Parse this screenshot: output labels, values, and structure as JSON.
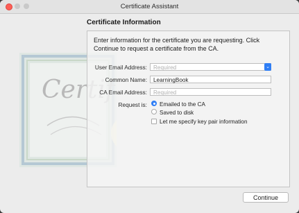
{
  "window": {
    "title": "Certificate Assistant"
  },
  "section": {
    "title": "Certificate Information"
  },
  "intro": "Enter information for the certificate you are requesting. Click Continue to request a certificate from the CA.",
  "artwork": {
    "script_text": "Certif"
  },
  "form": {
    "user_email": {
      "label": "User Email Address:",
      "placeholder": "Required",
      "value": ""
    },
    "common_name": {
      "label": "Common Name:",
      "value": "LearningBook"
    },
    "ca_email": {
      "label": "CA Email Address:",
      "placeholder": "Required",
      "value": ""
    },
    "request": {
      "label": "Request is:",
      "options": [
        "Emailed to the CA",
        "Saved to disk"
      ],
      "selected": "Emailed to the CA"
    },
    "keypair_checkbox": {
      "label": "Let me specify key pair information",
      "checked": false
    }
  },
  "buttons": {
    "continue": "Continue"
  },
  "colors": {
    "accent": "#2f7ef5",
    "close": "#fd5f57"
  }
}
